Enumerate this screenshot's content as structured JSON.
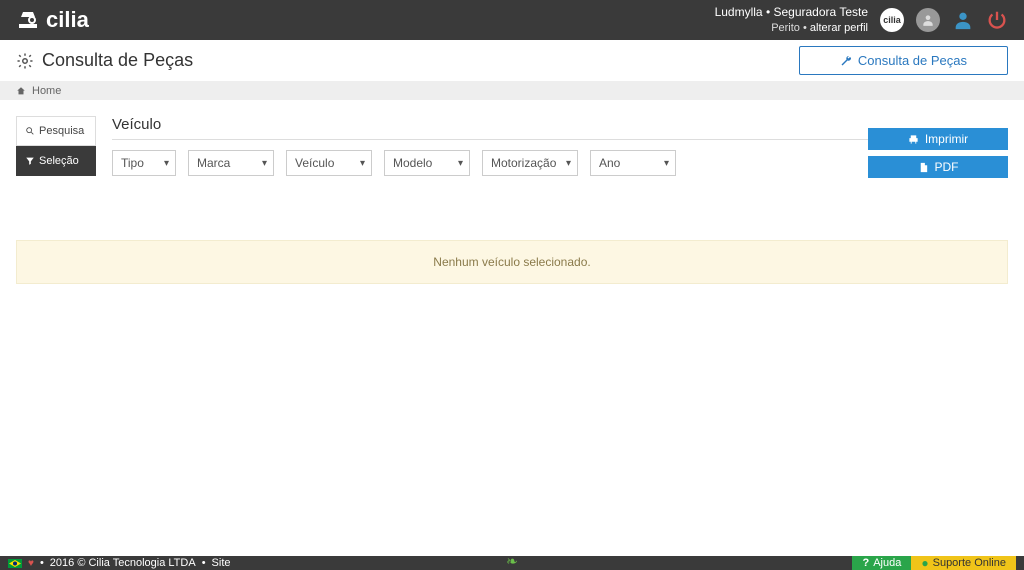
{
  "header": {
    "brand": "cilia",
    "user_name": "Ludmylla",
    "company": "Seguradora Teste",
    "role": "Perito",
    "change_profile_label": "alterar perfil"
  },
  "page": {
    "title": "Consulta de Peças",
    "main_button_label": "Consulta de Peças"
  },
  "breadcrumb": {
    "home_label": "Home"
  },
  "sidebar": {
    "items": [
      {
        "label": "Pesquisa",
        "active": false
      },
      {
        "label": "Seleção",
        "active": true
      }
    ]
  },
  "vehicle": {
    "section_title": "Veículo",
    "selects": {
      "tipo": "Tipo",
      "marca": "Marca",
      "veiculo": "Veículo",
      "modelo": "Modelo",
      "motorizacao": "Motorização",
      "ano": "Ano"
    }
  },
  "actions": {
    "print_label": "Imprimir",
    "pdf_label": "PDF"
  },
  "alert": {
    "message": "Nenhum veículo selecionado."
  },
  "footer": {
    "copyright": "2016 © Cilia Tecnologia LTDA",
    "site_label": "Site",
    "help_label": "Ajuda",
    "support_label": "Suporte Online"
  }
}
